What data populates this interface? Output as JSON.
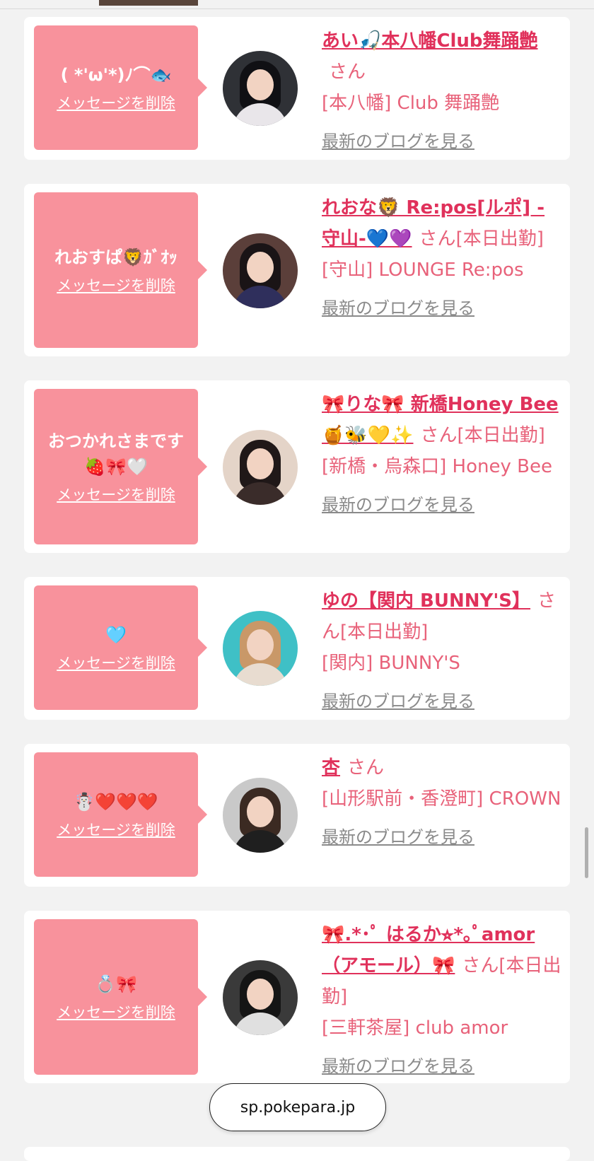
{
  "url": "sp.pokepara.jp",
  "delete_label": "メッセージを削除",
  "blog_label": "最新のブログを見る",
  "san": "さん",
  "cards": [
    {
      "message": "( *'ω'*)ﾉ⌒🐟",
      "name": "あい🎣本八幡Club舞踊艶",
      "suffix": "",
      "shop": "[本八幡] Club 舞踊艶",
      "avatar_colors": {
        "bg": "#2f3136",
        "hair": "#101014",
        "body": "#e9e6ea"
      }
    },
    {
      "message": "れおすぱ🦁ｶﾞｵｯ",
      "name": "れおな🦁 Re:pos[ルポ] -守山-💙💜",
      "suffix": "[本日出勤]",
      "shop": "[守山] LOUNGE Re:pos",
      "avatar_colors": {
        "bg": "#5b3f3a",
        "hair": "#1a1416",
        "body": "#2f2f5c"
      }
    },
    {
      "message": "おつかれさまです🍓🎀🤍",
      "name": "🎀りな🎀 新橋Honey Bee 🍯🐝💛✨",
      "suffix": "[本日出勤]",
      "shop": "[新橋・烏森口] Honey Bee",
      "avatar_colors": {
        "bg": "#e4d4c8",
        "hair": "#201818",
        "body": "#3a2c2a"
      }
    },
    {
      "message": "🩵",
      "name": "ゆの【関内 BUNNY'S】",
      "suffix": "[本日出勤]",
      "shop": "[関内] BUNNY'S",
      "avatar_colors": {
        "bg": "#3fc0c6",
        "hair": "#c99868",
        "body": "#e8dcd0"
      }
    },
    {
      "message": "☃️❤️❤️❤️",
      "name": "杏",
      "suffix": "",
      "shop": "[山形駅前・香澄町] CROWN",
      "avatar_colors": {
        "bg": "#c9c9c9",
        "hair": "#3b2a22",
        "body": "#1f1f1f"
      }
    },
    {
      "message": "💍🎀",
      "name": "🎀.*･ﾟ はるか⭐︎*｡ﾟamor（アモール）🎀",
      "suffix": "[本日出勤]",
      "shop": "[三軒茶屋] club amor",
      "avatar_colors": {
        "bg": "#3a3a3a",
        "hair": "#151515",
        "body": "#e0e0e0"
      }
    }
  ]
}
